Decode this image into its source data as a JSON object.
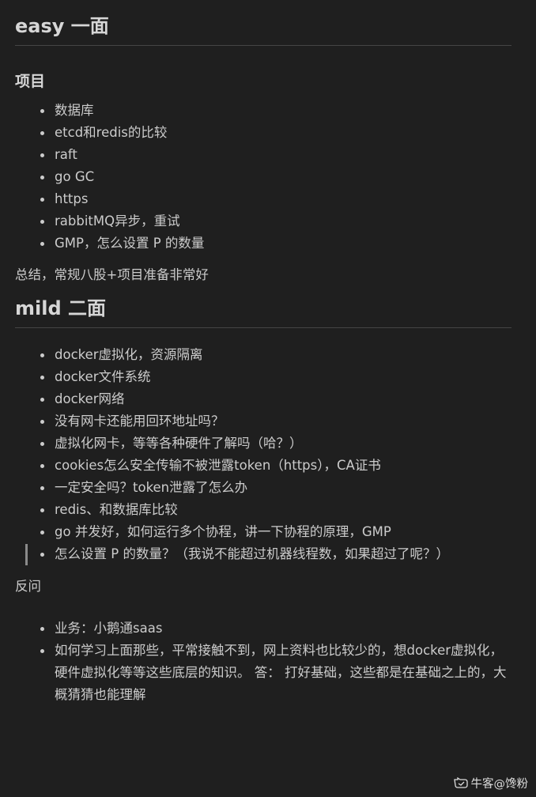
{
  "sections": {
    "easy": {
      "title": "easy 一面",
      "subtitle": "项目",
      "items": [
        "数据库",
        "etcd和redis的比较",
        "raft",
        "go GC",
        "https",
        "rabbitMQ异步，重试",
        "GMP，怎么设置 P 的数量"
      ],
      "summary": "总结，常规八股+项目准备非常好"
    },
    "mild": {
      "title": "mild 二面",
      "items": [
        "docker虚拟化，资源隔离",
        "docker文件系统",
        "docker网络",
        "没有网卡还能用回环地址吗？",
        "虚拟化网卡，等等各种硬件了解吗（哈？）",
        "cookies怎么安全传输不被泄露token（https），CA证书",
        "一定安全吗？token泄露了怎么办",
        "redis、和数据库比较",
        "go 并发好，如何运行多个协程，讲一下协程的原理，GMP",
        "怎么设置 P 的数量？（我说不能超过机器线程数，如果超过了呢？）"
      ]
    },
    "reverse": {
      "label": "反问",
      "items": [
        "业务：小鹅通saas",
        "如何学习上面那些，平常接触不到，网上资料也比较少的，想docker虚拟化，硬件虚拟化等等这些底层的知识。 答： 打好基础，这些都是在基础之上的，大概猜猜也能理解"
      ]
    }
  },
  "watermark": {
    "text": "牛客@馋粉",
    "icon": "nowcoder-logo-icon"
  }
}
